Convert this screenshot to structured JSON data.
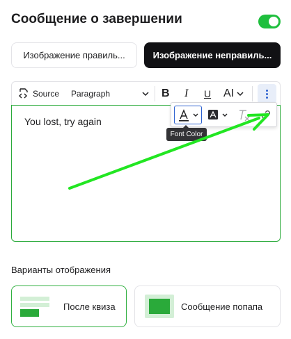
{
  "header": {
    "title": "Сообщение о завершении",
    "enabled": true
  },
  "image_buttons": {
    "correct_label": "Изображение правиль...",
    "incorrect_label": "Изображение неправиль..."
  },
  "toolbar": {
    "source_label": "Source",
    "paragraph_label": "Paragraph",
    "bold": "B",
    "italic": "I",
    "underline": "U",
    "font_size": "AI"
  },
  "editor": {
    "text": "You lost, try again"
  },
  "color_dropdown": {
    "tooltip": "Font Color"
  },
  "display_modes": {
    "title": "Варианты отображения",
    "after_quiz_label": "После квиза",
    "popup_label": "Сообщение попапа"
  },
  "colors": {
    "accent_green": "#1fbf3e",
    "selection_blue": "#2e63d0",
    "arrow_green": "#22e622"
  }
}
